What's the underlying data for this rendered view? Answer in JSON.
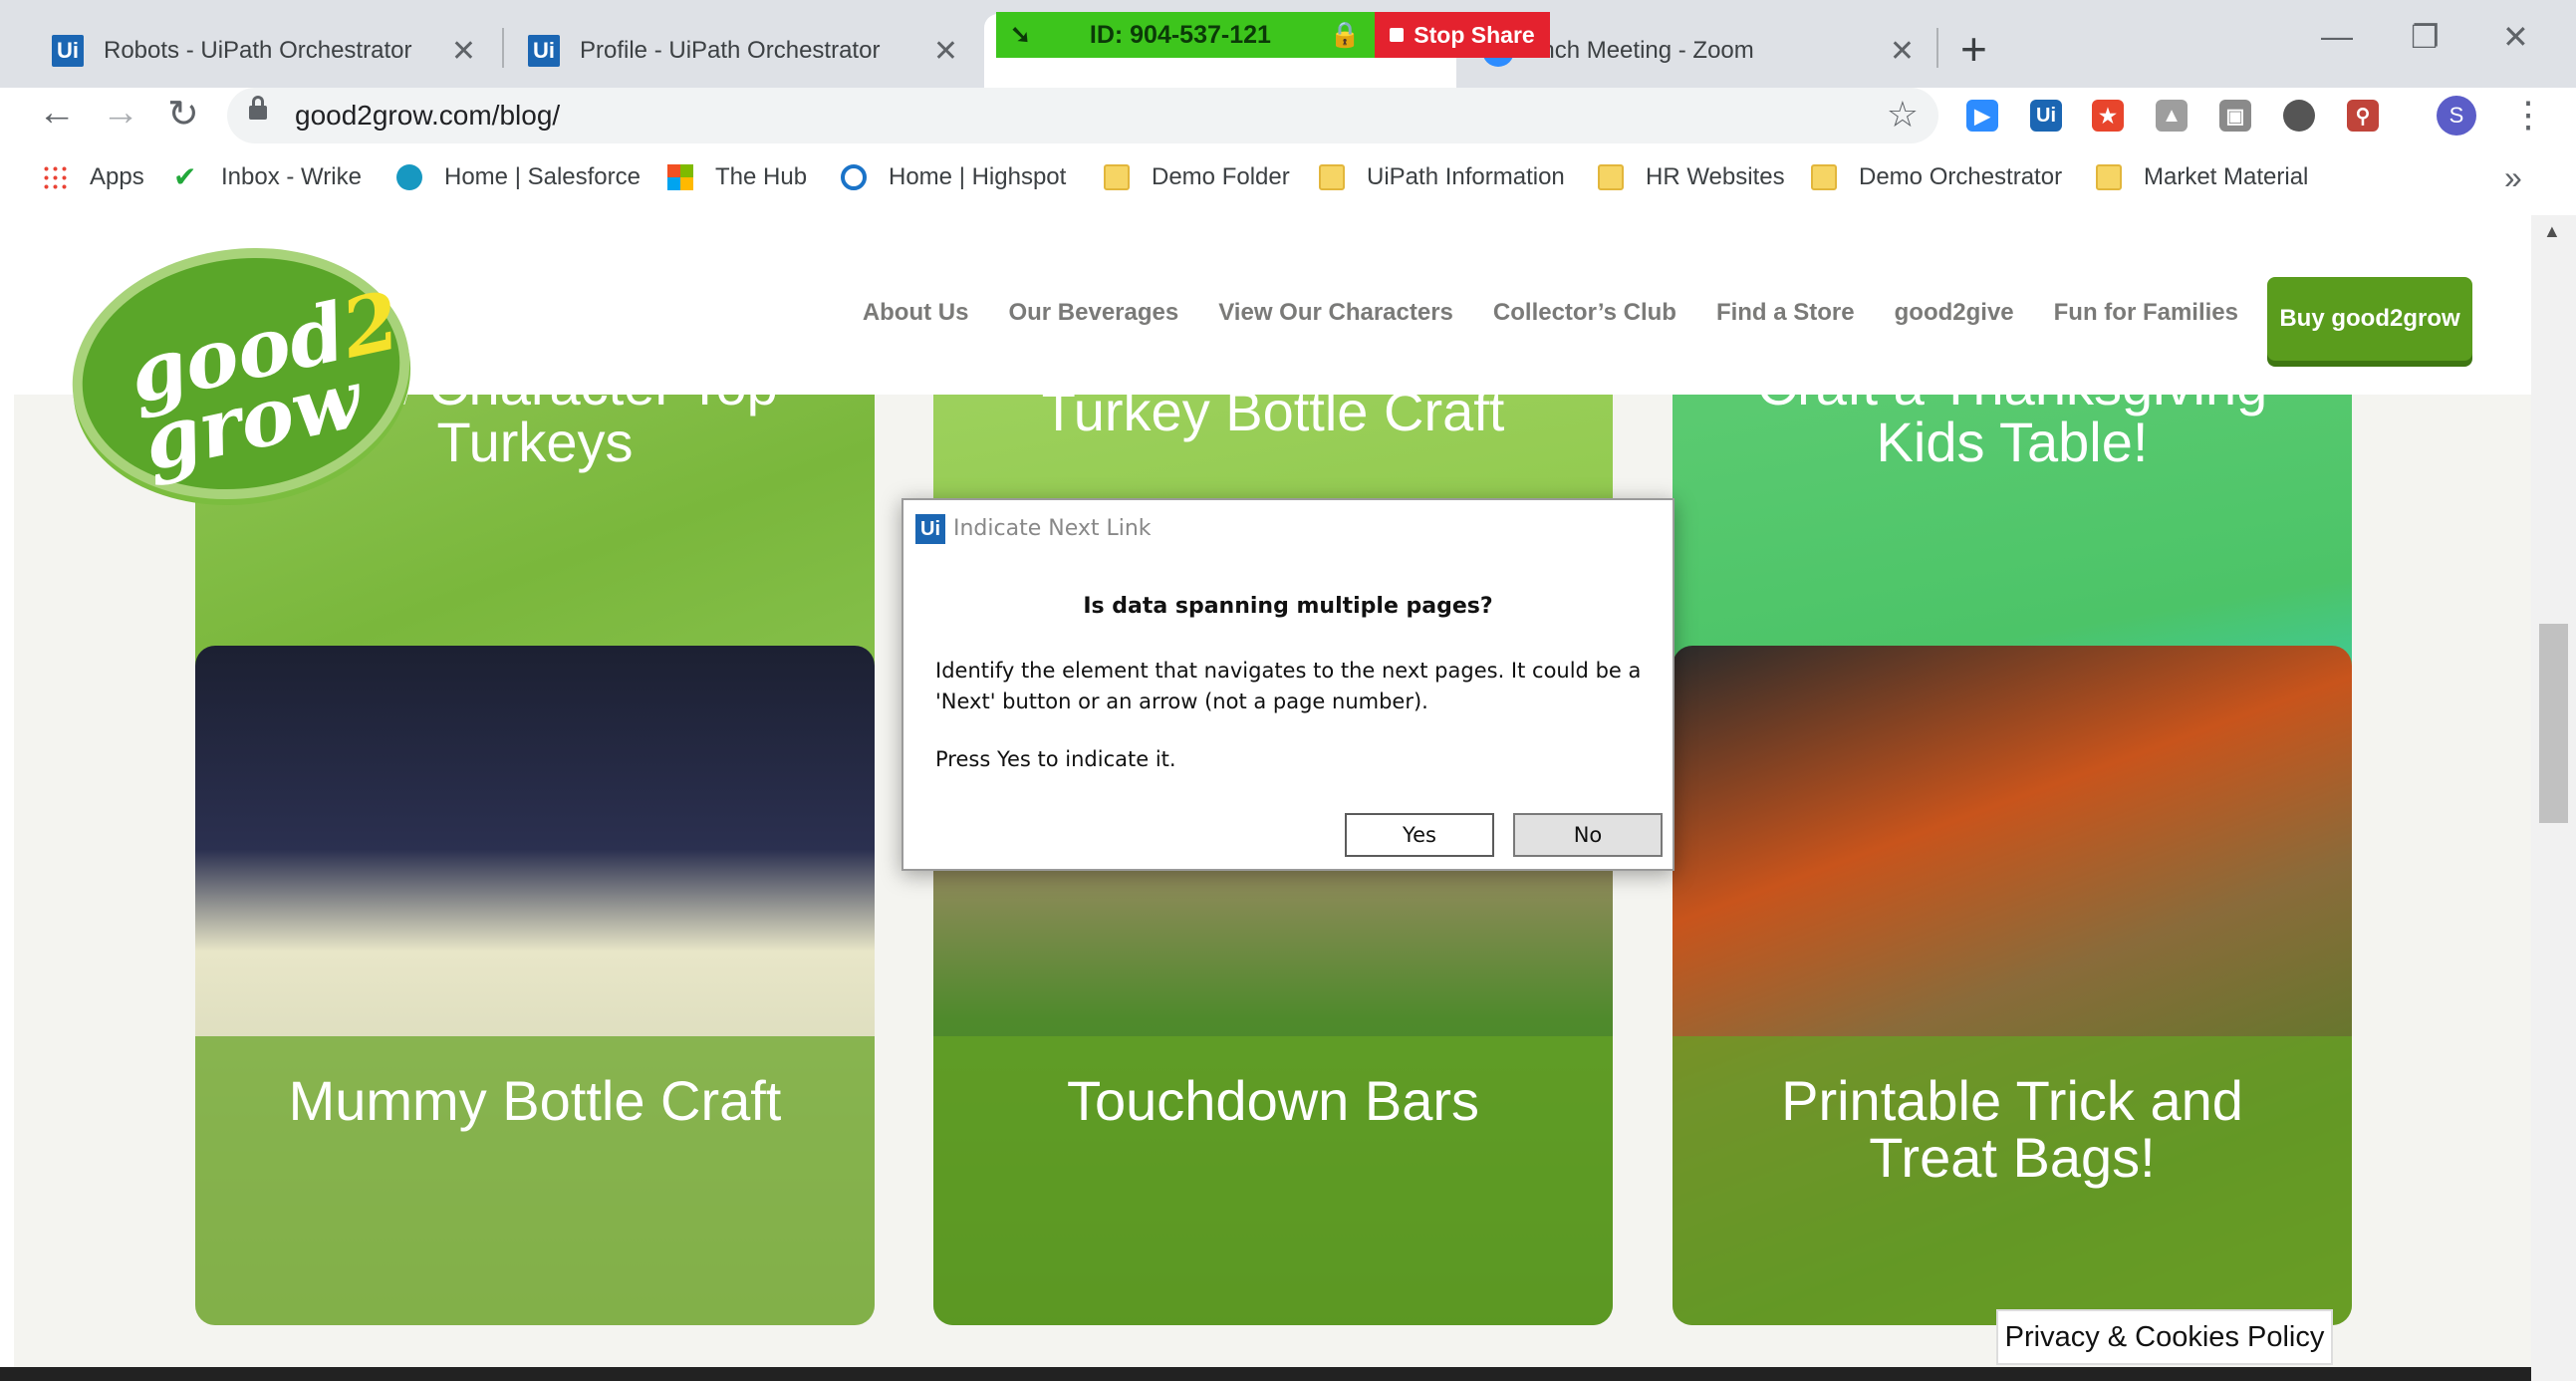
{
  "browser": {
    "tabs": [
      {
        "label": "Robots - UiPath Orchestrator",
        "favicon": "Ui"
      },
      {
        "label": "Profile - UiPath Orchestrator",
        "favicon": "Ui"
      },
      {
        "label": "",
        "favicon": ""
      },
      {
        "label": "unch Meeting - Zoom",
        "favicon": "zoom-icon"
      }
    ],
    "new_tab": "+",
    "window_controls": {
      "minimize": "—",
      "restore": "❐",
      "close": "✕"
    },
    "share_bar": {
      "meeting_id": "ID: 904-537-121",
      "stop_label": "Stop Share"
    },
    "nav": {
      "back": "←",
      "forward": "→",
      "reload": "↻"
    },
    "url": "good2grow.com/blog/",
    "star": "☆",
    "extensions": [
      "zoom",
      "Ui",
      "office",
      "drive",
      "book",
      "circle",
      "pdf"
    ],
    "profile_initial": "S",
    "menu": "⋮",
    "bookmarks": [
      {
        "label": "Apps",
        "icon": "apps-grid-icon"
      },
      {
        "label": "Inbox - Wrike",
        "icon": "wrike-check-icon"
      },
      {
        "label": "Home | Salesforce",
        "icon": "salesforce-cloud-icon"
      },
      {
        "label": "The Hub",
        "icon": "microsoft-icon"
      },
      {
        "label": "Home | Highspot",
        "icon": "highspot-icon"
      },
      {
        "label": "Demo Folder",
        "icon": "folder-icon"
      },
      {
        "label": "UiPath Information",
        "icon": "folder-icon"
      },
      {
        "label": "HR Websites",
        "icon": "folder-icon"
      },
      {
        "label": "Demo Orchestrator",
        "icon": "folder-icon"
      },
      {
        "label": "Market Material",
        "icon": "folder-icon"
      }
    ],
    "bookmarks_more": "»"
  },
  "site": {
    "logo": {
      "line1": "good",
      "two": "2",
      "line2": "grow"
    },
    "nav": [
      "About Us",
      "Our Beverages",
      "View Our Characters",
      "Collector’s Club",
      "Find a Store",
      "good2give",
      "Fun for Families"
    ],
    "buy_button": "Buy good2grow",
    "cards_top": [
      "grow Character Top Turkeys",
      "Turkey Bottle Craft",
      "Craft a Thanksgiving Kids Table!"
    ],
    "cards": [
      "Mummy Bottle Craft",
      "Touchdown Bars",
      "Printable Trick and Treat Bags!"
    ],
    "privacy": "Privacy & Cookies Policy"
  },
  "dialog": {
    "icon": "Ui",
    "title": "Indicate Next Link",
    "heading": "Is data spanning multiple pages?",
    "body": "Identify the element that navigates to the next pages. It could be a 'Next' button or an arrow (not a page number).",
    "prompt": "Press Yes to indicate it.",
    "yes": "Yes",
    "no": "No"
  }
}
